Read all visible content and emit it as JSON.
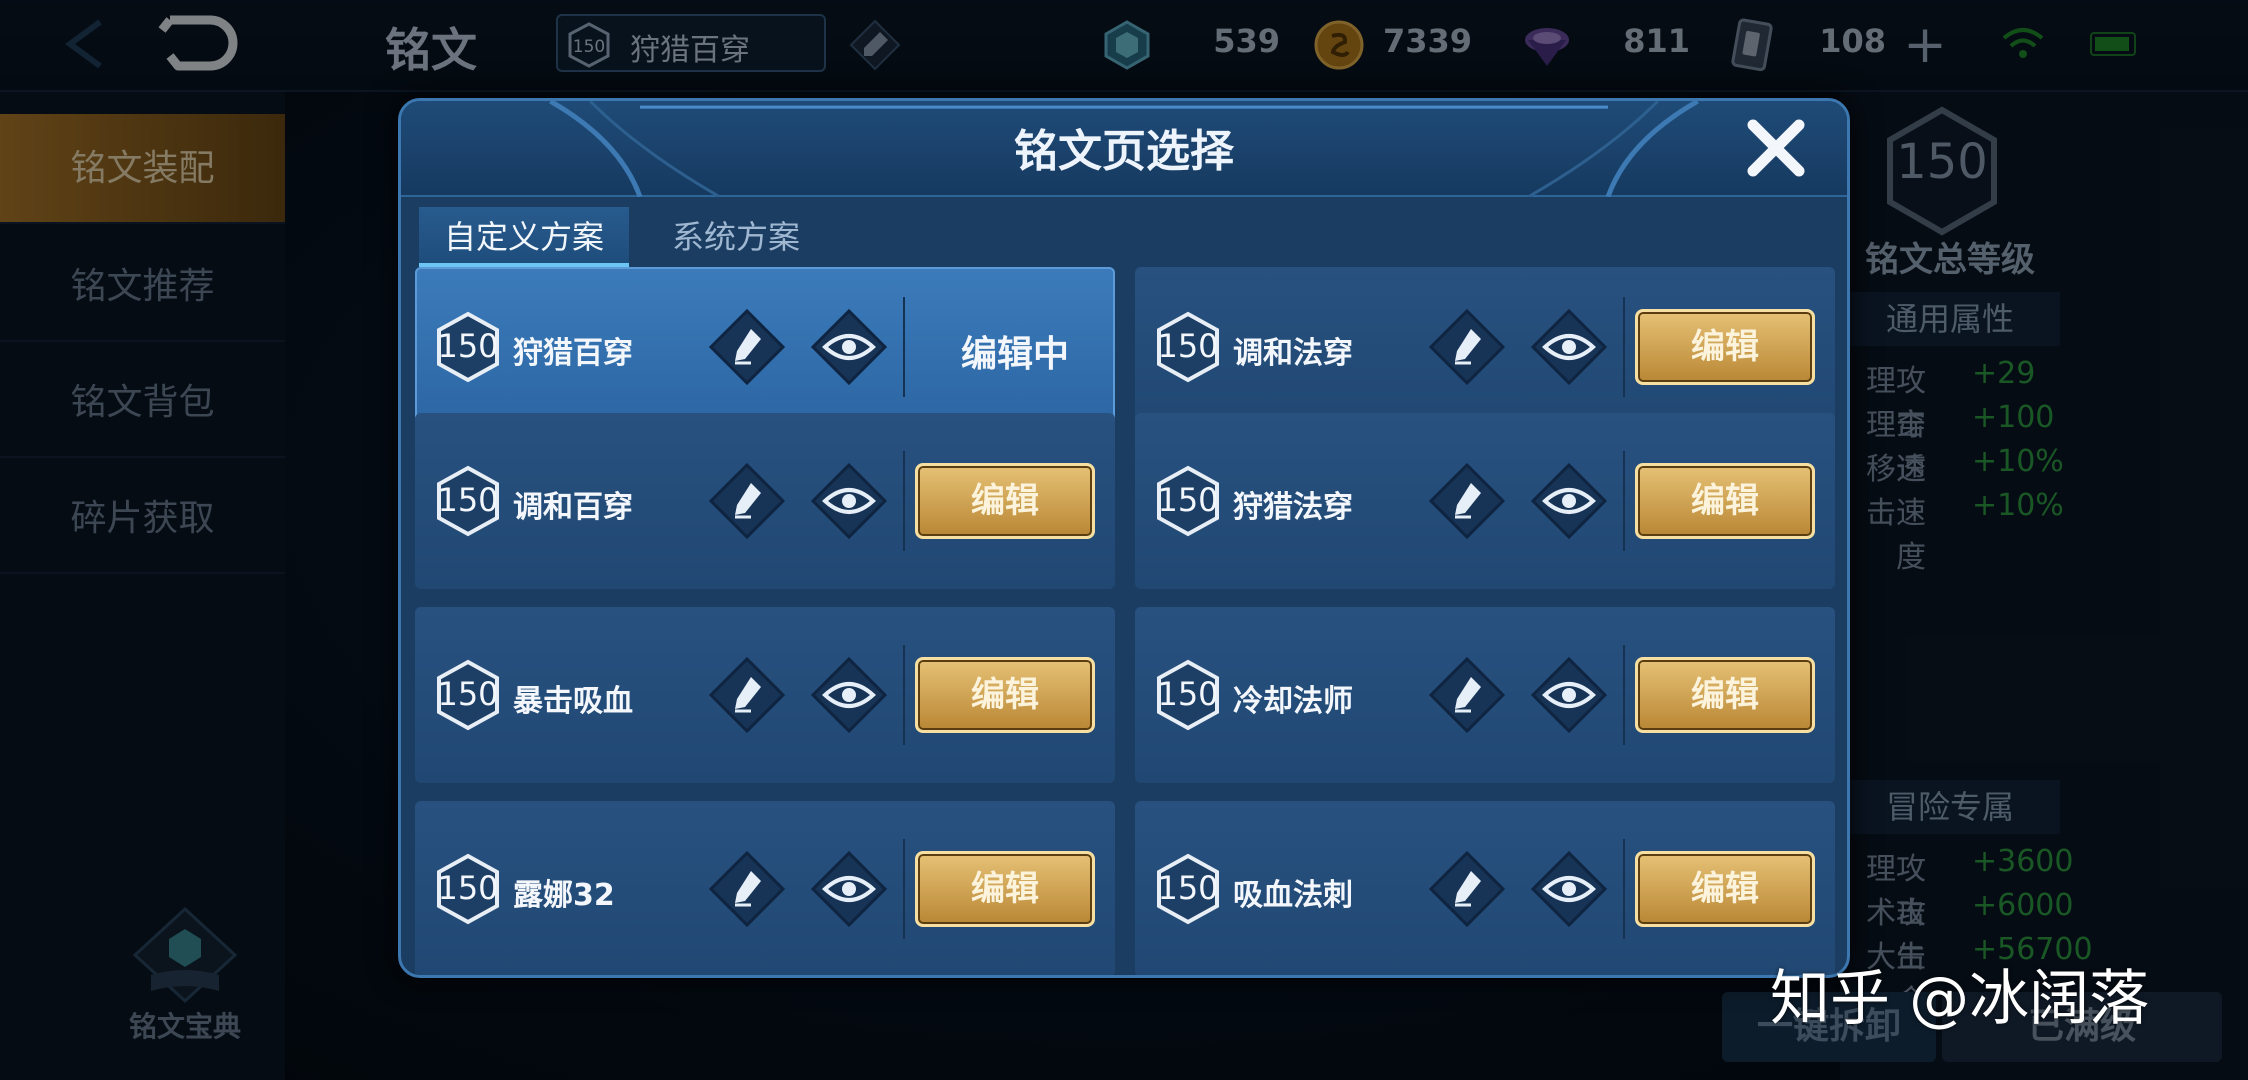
{
  "top_bar": {
    "title": "铭文",
    "current_page": {
      "level": "150",
      "name": "狩猎百穿"
    },
    "currencies": [
      {
        "icon": "crystal-icon",
        "value": "539"
      },
      {
        "icon": "gold-coin-icon",
        "value": "7339"
      },
      {
        "icon": "purple-gem-icon",
        "value": "811"
      },
      {
        "icon": "card-icon",
        "value": "108"
      }
    ]
  },
  "left_menu": {
    "items": [
      {
        "label": "铭文装配",
        "active": true
      },
      {
        "label": "铭文推荐",
        "active": false
      },
      {
        "label": "铭文背包",
        "active": false
      },
      {
        "label": "碎片获取",
        "active": false
      }
    ],
    "bottom_label": "铭文宝典"
  },
  "right_panel": {
    "total_level": "150",
    "total_level_label": "铭文总等级",
    "general_header": "通用属性",
    "general_attrs": [
      {
        "name": "理攻击",
        "value": "+29"
      },
      {
        "name": "理穿透",
        "value": "+100"
      },
      {
        "name": "移速",
        "value": "+10%"
      },
      {
        "name": "击速度",
        "value": "+10%"
      }
    ],
    "adventure_header": "冒险专属",
    "adventure_attrs": [
      {
        "name": "理攻击",
        "value": "+3600"
      },
      {
        "name": "术攻击",
        "value": "+6000"
      },
      {
        "name": "大生命",
        "value": "+56700"
      }
    ],
    "unload_label": "一键拆卸",
    "maxed_label": "已满级"
  },
  "dialog": {
    "title": "铭文页选择",
    "tabs": [
      "自定义方案",
      "系统方案"
    ],
    "edit_label": "编辑",
    "editing_label": "编辑中",
    "pages": [
      {
        "level": "150",
        "name": "狩猎百穿",
        "active": true
      },
      {
        "level": "150",
        "name": "调和法穿",
        "active": false
      },
      {
        "level": "150",
        "name": "调和百穿",
        "active": false
      },
      {
        "level": "150",
        "name": "狩猎法穿",
        "active": false
      },
      {
        "level": "150",
        "name": "暴击吸血",
        "active": false
      },
      {
        "level": "150",
        "name": "冷却法师",
        "active": false
      },
      {
        "level": "150",
        "name": "露娜32",
        "active": false
      },
      {
        "level": "150",
        "name": "吸血法刺",
        "active": false
      }
    ]
  },
  "watermark": "知乎 @冰阔落",
  "colors": {
    "gold_button": "#d4a857",
    "panel_blue": "#214873",
    "active_blue": "#3470ae",
    "green_text": "#2f9f44"
  }
}
